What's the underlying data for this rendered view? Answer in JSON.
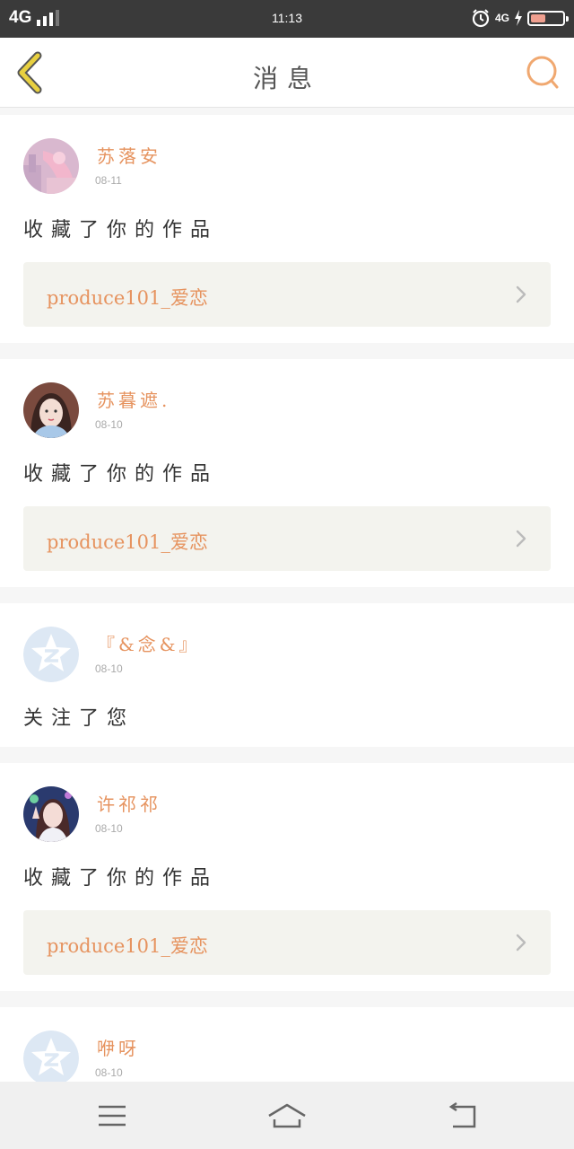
{
  "status_bar": {
    "network": "4G",
    "time": "11:13",
    "network_right": "4G"
  },
  "header": {
    "title": "消息",
    "back_icon": "chevron-left-icon",
    "search_icon": "search-icon"
  },
  "colors": {
    "accent": "#e6935f",
    "back_chevron": "#e8d040",
    "link_bg": "#f3f3ee"
  },
  "notifications": [
    {
      "name": "苏落安",
      "date": "08-11",
      "action": "收藏了你的作品",
      "work": "produce101_爱恋"
    },
    {
      "name": "苏暮遮.",
      "date": "08-10",
      "action": "收藏了你的作品",
      "work": "produce101_爱恋"
    },
    {
      "name": "『&念&』",
      "date": "08-10",
      "action": "关注了您"
    },
    {
      "name": "许祁祁",
      "date": "08-10",
      "action": "收藏了你的作品",
      "work": "produce101_爱恋"
    },
    {
      "name": "咿呀",
      "date": "08-10"
    }
  ],
  "nav": {
    "menu_icon": "menu-icon",
    "home_icon": "home-icon",
    "back_icon": "back-arrow-icon"
  }
}
